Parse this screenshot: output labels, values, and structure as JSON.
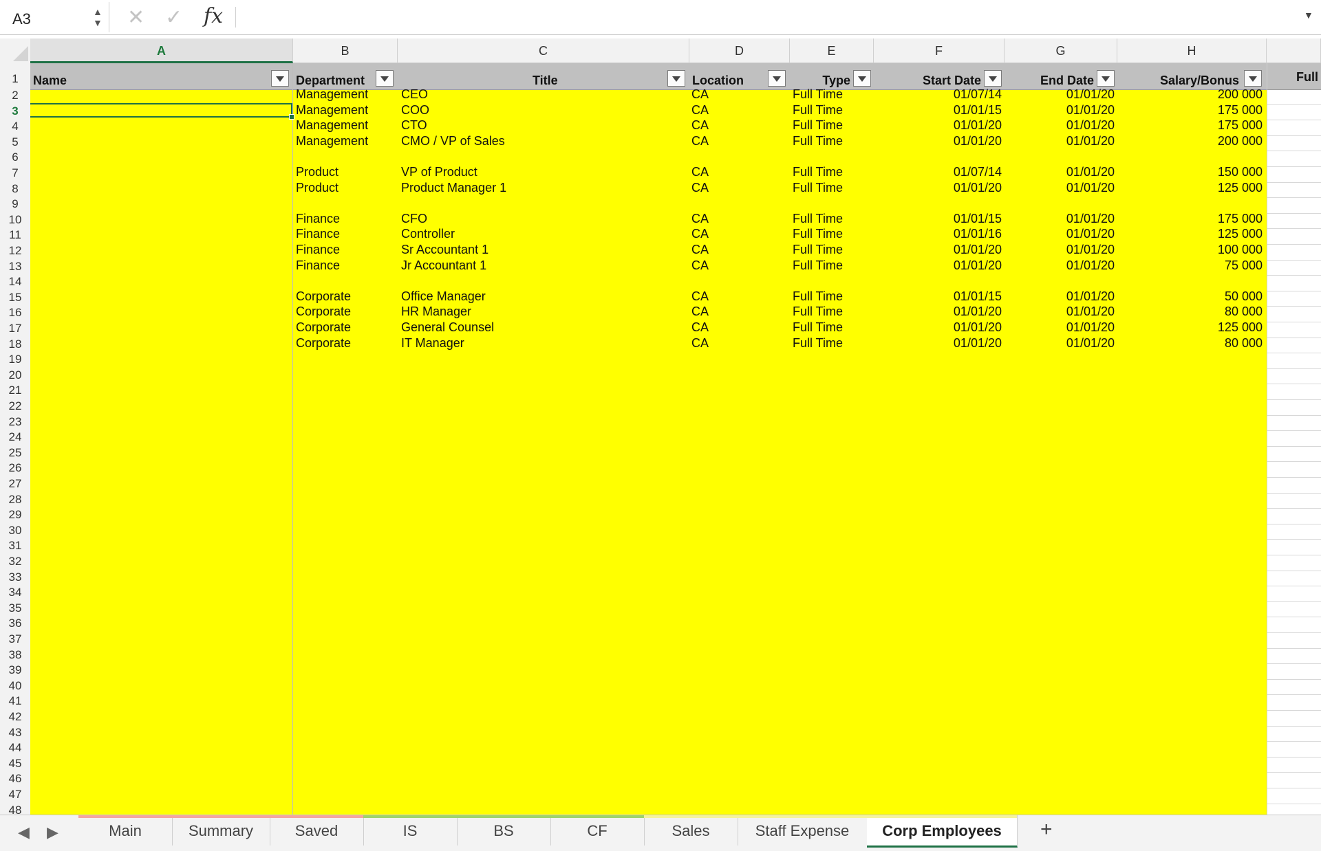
{
  "formula_bar": {
    "cell_ref": "A3",
    "formula": "",
    "fx_label": "fx"
  },
  "columns": [
    {
      "letter": "A",
      "header": "Name"
    },
    {
      "letter": "B",
      "header": "Department"
    },
    {
      "letter": "C",
      "header": "Title"
    },
    {
      "letter": "D",
      "header": "Location"
    },
    {
      "letter": "E",
      "header": "Type"
    },
    {
      "letter": "F",
      "header": "Start Date"
    },
    {
      "letter": "G",
      "header": "End Date"
    },
    {
      "letter": "H",
      "header": "Salary/Bonus"
    },
    {
      "letter": "",
      "header": "Full"
    }
  ],
  "selected_cell": "A3",
  "rows": [
    {
      "row": 2,
      "name": "",
      "department": "Management",
      "title": "CEO",
      "location": "CA",
      "type": "Full Time",
      "start": "01/07/14",
      "end": "01/01/20",
      "salary": "200 000"
    },
    {
      "row": 3,
      "name": "",
      "department": "Management",
      "title": "COO",
      "location": "CA",
      "type": "Full Time",
      "start": "01/01/15",
      "end": "01/01/20",
      "salary": "175 000"
    },
    {
      "row": 4,
      "name": "",
      "department": "Management",
      "title": "CTO",
      "location": "CA",
      "type": "Full Time",
      "start": "01/01/20",
      "end": "01/01/20",
      "salary": "175 000"
    },
    {
      "row": 5,
      "name": "",
      "department": "Management",
      "title": "CMO / VP of Sales",
      "location": "CA",
      "type": "Full Time",
      "start": "01/01/20",
      "end": "01/01/20",
      "salary": "200 000"
    },
    {
      "row": 7,
      "name": "",
      "department": "Product",
      "title": "VP of Product",
      "location": "CA",
      "type": "Full Time",
      "start": "01/07/14",
      "end": "01/01/20",
      "salary": "150 000"
    },
    {
      "row": 8,
      "name": "",
      "department": "Product",
      "title": "Product Manager 1",
      "location": "CA",
      "type": "Full Time",
      "start": "01/01/20",
      "end": "01/01/20",
      "salary": "125 000"
    },
    {
      "row": 10,
      "name": "",
      "department": "Finance",
      "title": "CFO",
      "location": "CA",
      "type": "Full Time",
      "start": "01/01/15",
      "end": "01/01/20",
      "salary": "175 000"
    },
    {
      "row": 11,
      "name": "",
      "department": "Finance",
      "title": "Controller",
      "location": "CA",
      "type": "Full Time",
      "start": "01/01/16",
      "end": "01/01/20",
      "salary": "125 000"
    },
    {
      "row": 12,
      "name": "",
      "department": "Finance",
      "title": "Sr Accountant 1",
      "location": "CA",
      "type": "Full Time",
      "start": "01/01/20",
      "end": "01/01/20",
      "salary": "100 000"
    },
    {
      "row": 13,
      "name": "",
      "department": "Finance",
      "title": "Jr Accountant 1",
      "location": "CA",
      "type": "Full Time",
      "start": "01/01/20",
      "end": "01/01/20",
      "salary": "75 000"
    },
    {
      "row": 15,
      "name": "",
      "department": "Corporate",
      "title": "Office Manager",
      "location": "CA",
      "type": "Full Time",
      "start": "01/01/15",
      "end": "01/01/20",
      "salary": "50 000"
    },
    {
      "row": 16,
      "name": "",
      "department": "Corporate",
      "title": "HR Manager",
      "location": "CA",
      "type": "Full Time",
      "start": "01/01/20",
      "end": "01/01/20",
      "salary": "80 000"
    },
    {
      "row": 17,
      "name": "",
      "department": "Corporate",
      "title": "General Counsel",
      "location": "CA",
      "type": "Full Time",
      "start": "01/01/20",
      "end": "01/01/20",
      "salary": "125 000"
    },
    {
      "row": 18,
      "name": "",
      "department": "Corporate",
      "title": "IT Manager",
      "location": "CA",
      "type": "Full Time",
      "start": "01/01/20",
      "end": "01/01/20",
      "salary": "80 000"
    }
  ],
  "row_numbers": [
    "1",
    "2",
    "3",
    "4",
    "5",
    "6",
    "7",
    "8",
    "9",
    "10",
    "11",
    "12",
    "13",
    "14",
    "15",
    "16",
    "17",
    "18",
    "19",
    "20",
    "21",
    "22",
    "23",
    "24",
    "25",
    "26",
    "27",
    "28",
    "29",
    "30",
    "31",
    "32",
    "33",
    "34",
    "35",
    "36",
    "37",
    "38",
    "39",
    "40",
    "41",
    "42",
    "43",
    "44",
    "45",
    "46",
    "47",
    "48"
  ],
  "sheet_tabs": [
    {
      "label": "Main",
      "color": "#f4a6a0",
      "active": false
    },
    {
      "label": "Summary",
      "color": "#f4a6a0",
      "active": false
    },
    {
      "label": "Saved",
      "color": "#f4a6a0",
      "active": false
    },
    {
      "label": "IS",
      "color": "#9fd36b",
      "active": false
    },
    {
      "label": "BS",
      "color": "#9fd36b",
      "active": false
    },
    {
      "label": "CF",
      "color": "#9fd36b",
      "active": false
    },
    {
      "label": "Sales",
      "color": "#f5f39b",
      "active": false
    },
    {
      "label": "Staff Expense",
      "color": "#f5f39b",
      "active": false
    },
    {
      "label": "Corp Employees",
      "color": "#f5f39b",
      "active": true
    }
  ],
  "add_sheet_label": "+",
  "colors": {
    "fill": "#ffff00",
    "header_fill": "#c0c0c0",
    "selection": "#1e7145"
  }
}
